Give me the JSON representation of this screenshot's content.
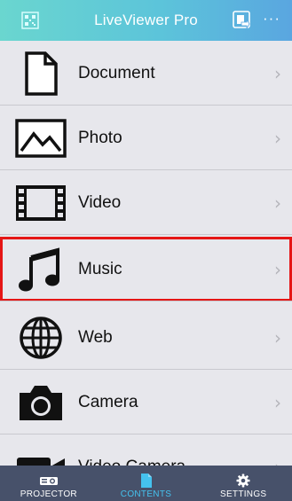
{
  "header": {
    "title": "LiveViewer Pro",
    "more_glyph": "···"
  },
  "list": {
    "items": [
      {
        "label": "Document",
        "icon": "document-icon",
        "chevron": "›"
      },
      {
        "label": "Photo",
        "icon": "photo-icon",
        "chevron": "›"
      },
      {
        "label": "Video",
        "icon": "film-icon",
        "chevron": "›"
      },
      {
        "label": "Music",
        "icon": "music-note-icon",
        "chevron": "›",
        "selected": true
      },
      {
        "label": "Web",
        "icon": "globe-icon",
        "chevron": "›"
      },
      {
        "label": "Camera",
        "icon": "camera-icon",
        "chevron": "›"
      },
      {
        "label": "Video Camera",
        "icon": "video-camera-icon",
        "chevron": "›"
      }
    ]
  },
  "tabbar": {
    "tabs": [
      {
        "label": "PROJECTOR",
        "icon": "projector-icon"
      },
      {
        "label": "CONTENTS",
        "icon": "file-icon",
        "active": true
      },
      {
        "label": "SETTINGS",
        "icon": "gear-icon"
      }
    ]
  },
  "colors": {
    "header_start": "#6ad6cf",
    "header_end": "#5aa6e0",
    "list_bg": "#e7e7ec",
    "tabbar_bg": "#47516a",
    "active_tab": "#45c2ee",
    "selection_outline": "#e51616"
  }
}
